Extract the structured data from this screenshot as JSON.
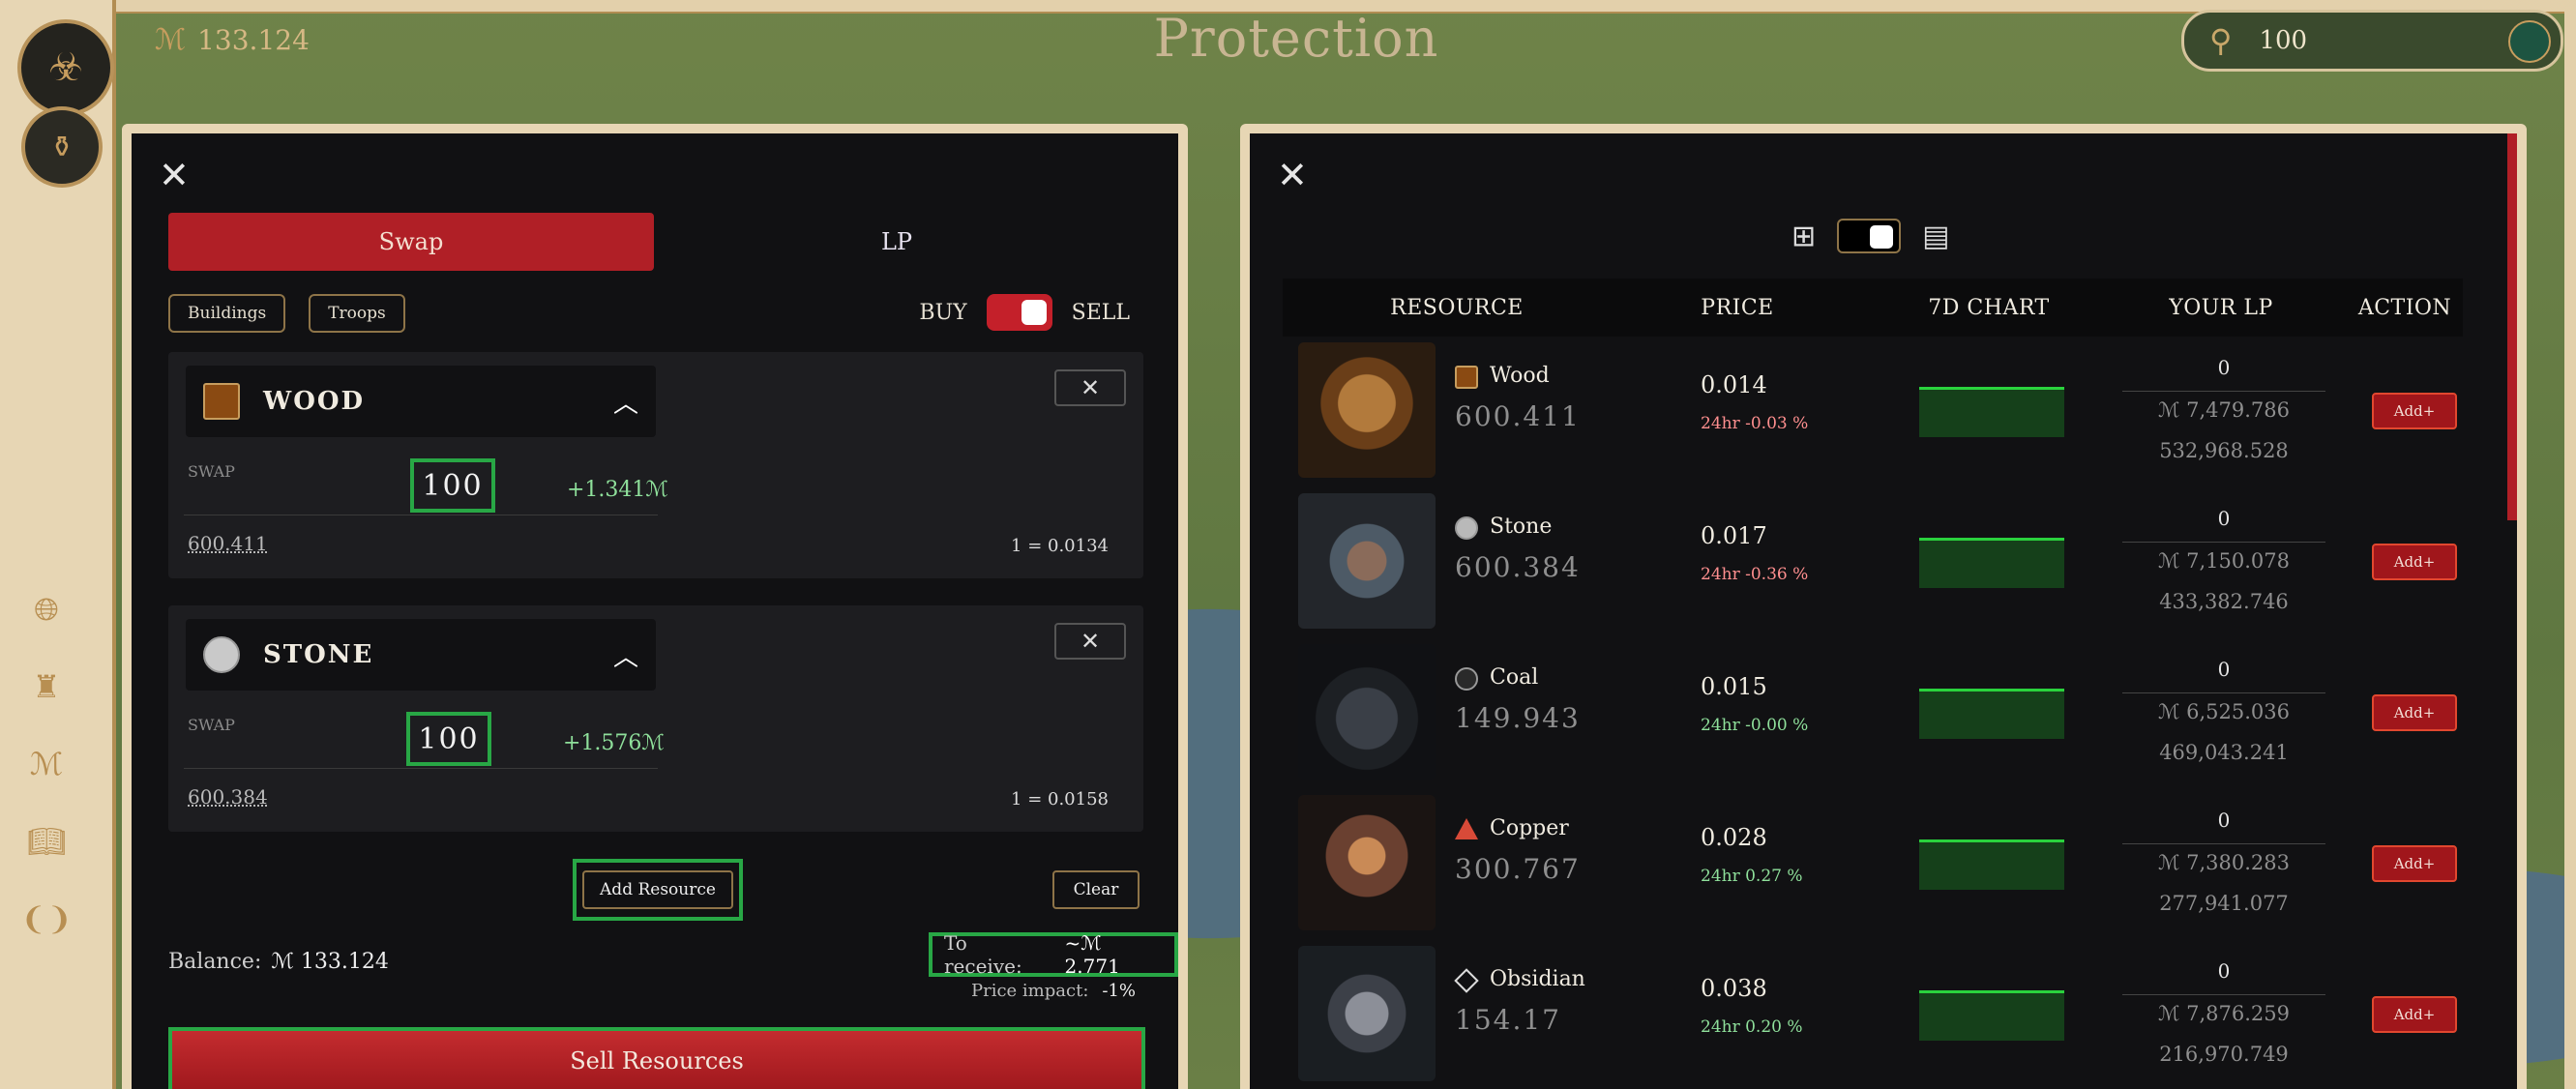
{
  "header": {
    "balance": "133.124",
    "lords_symbol": "ℳ",
    "title": "Protection",
    "search_value": "100"
  },
  "swap_panel": {
    "tabs": [
      "Swap",
      "LP"
    ],
    "filters": [
      "Buildings",
      "Troops"
    ],
    "buy_label": "BUY",
    "sell_label": "SELL",
    "resources": [
      {
        "name": "WOOD",
        "swap_label": "SWAP",
        "amount": "100",
        "gain": "+1.341ℳ",
        "balance": "600.411",
        "rate": "1 = 0.0134",
        "color": "#8a4a12"
      },
      {
        "name": "STONE",
        "swap_label": "SWAP",
        "amount": "100",
        "gain": "+1.576ℳ",
        "balance": "600.384",
        "rate": "1 = 0.0158",
        "color": "#c9c9c9"
      }
    ],
    "add_resource": "Add Resource",
    "clear": "Clear",
    "balance_label": "Balance:",
    "balance_value": "ℳ 133.124",
    "receive_label": "To receive:",
    "receive_value": "~ℳ 2.771",
    "impact_label": "Price impact:",
    "impact_value": "-1%",
    "sell_button": "Sell Resources"
  },
  "market_panel": {
    "columns": [
      "RESOURCE",
      "PRICE",
      "7D CHART",
      "YOUR LP",
      "ACTION"
    ],
    "rows": [
      {
        "name": "Wood",
        "amount": "600.411",
        "price": "0.014",
        "change": "24hr -0.03 %",
        "change_dir": "neg",
        "lp": "0",
        "lp_value": "ℳ 7,479.786",
        "lp_value2": "532,968.528",
        "action": "Add+",
        "icon_color": "#8a4a12",
        "thumb": "wood"
      },
      {
        "name": "Stone",
        "amount": "600.384",
        "price": "0.017",
        "change": "24hr -0.36 %",
        "change_dir": "neg",
        "lp": "0",
        "lp_value": "ℳ 7,150.078",
        "lp_value2": "433,382.746",
        "action": "Add+",
        "icon_color": "#b9b9b9",
        "thumb": "stone"
      },
      {
        "name": "Coal",
        "amount": "149.943",
        "price": "0.015",
        "change": "24hr -0.00 %",
        "change_dir": "pos",
        "lp": "0",
        "lp_value": "ℳ 6,525.036",
        "lp_value2": "469,043.241",
        "action": "Add+",
        "icon_color": "#2a2a2a",
        "thumb": "coal"
      },
      {
        "name": "Copper",
        "amount": "300.767",
        "price": "0.028",
        "change": "24hr 0.27 %",
        "change_dir": "pos",
        "lp": "0",
        "lp_value": "ℳ 7,380.283",
        "lp_value2": "277,941.077",
        "action": "Add+",
        "icon_color": "#d84a38",
        "thumb": "copper"
      },
      {
        "name": "Obsidian",
        "amount": "154.17",
        "price": "0.038",
        "change": "24hr 0.20 %",
        "change_dir": "pos",
        "lp": "0",
        "lp_value": "ℳ 7,876.259",
        "lp_value2": "216,970.749",
        "action": "Add+",
        "icon_color": "#9a9a9a",
        "thumb": "obsidian"
      }
    ]
  }
}
